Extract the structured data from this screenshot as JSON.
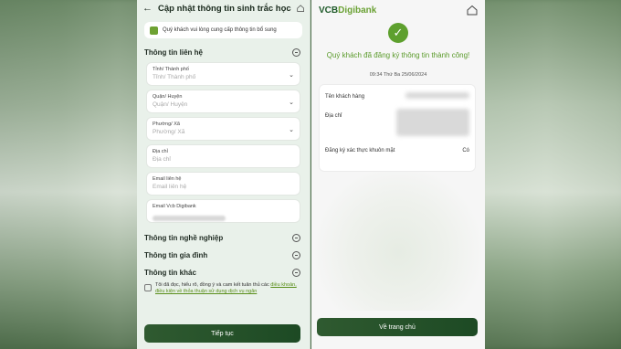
{
  "left": {
    "title": "Cập nhật thông tin sinh trắc học",
    "info": "Quý khách vui lòng cung cấp thông tin bổ sung",
    "contact_section": "Thông tin liên hệ",
    "fields": [
      {
        "label": "Tỉnh/ Thành phố",
        "placeholder": "Tỉnh/ Thành phố"
      },
      {
        "label": "Quận/ Huyện",
        "placeholder": "Quận/ Huyện"
      },
      {
        "label": "Phường/ Xã",
        "placeholder": "Phường/ Xã"
      },
      {
        "label": "Địa chỉ",
        "placeholder": "Địa chỉ"
      },
      {
        "label": "Email liên hệ",
        "placeholder": "Email liên hệ"
      },
      {
        "label": "Email Vcb Digibank",
        "placeholder": ""
      }
    ],
    "job_section": "Thông tin nghề nghiệp",
    "family_section": "Thông tin gia đình",
    "other_section": "Thông tin khác",
    "agree_text_1": "Tôi đã đọc, hiểu rõ, đồng ý và cam kết tuân thủ các ",
    "agree_link": "điều khoản, điều kiện về thỏa thuận sử dụng dịch vụ ngân",
    "continue_label": "Tiếp tục"
  },
  "right": {
    "brand_main": "VCB",
    "brand_sub": "Digibank",
    "success_message": "Quý khách đã đăng ký thông tin thành công!",
    "timestamp": "09:34 Thứ Ba 25/06/2024",
    "customer_name_label": "Tên khách hàng",
    "address_label": "Địa chỉ",
    "face_auth_label": "Đăng ký xác thực khuôn mặt",
    "face_auth_value": "Có",
    "home_button": "Về trang chủ"
  }
}
